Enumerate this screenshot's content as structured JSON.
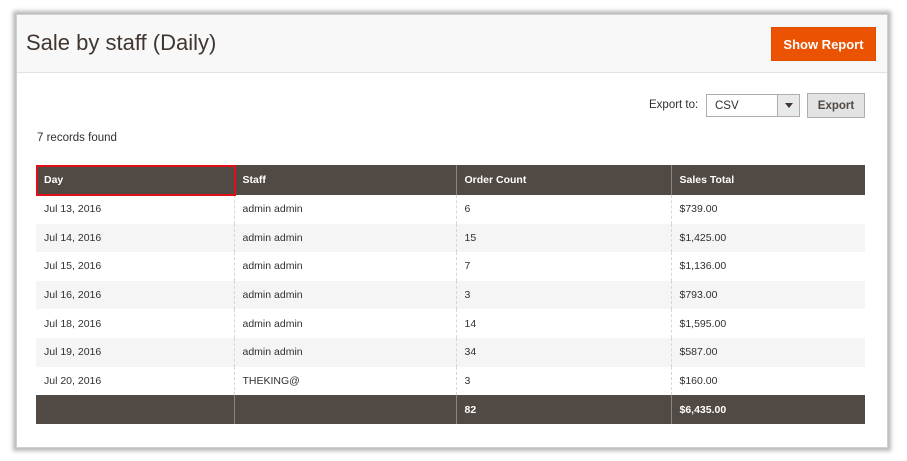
{
  "header": {
    "title": "Sale by staff (Daily)",
    "show_report_label": "Show Report"
  },
  "toolbar": {
    "export_label": "Export to:",
    "export_format": "CSV",
    "export_button": "Export"
  },
  "records_found": "7 records found",
  "grid": {
    "columns": [
      "Day",
      "Staff",
      "Order Count",
      "Sales Total"
    ],
    "rows": [
      [
        "Jul 13, 2016",
        "admin admin",
        "6",
        "$739.00"
      ],
      [
        "Jul 14, 2016",
        "admin admin",
        "15",
        "$1,425.00"
      ],
      [
        "Jul 15, 2016",
        "admin admin",
        "7",
        "$1,136.00"
      ],
      [
        "Jul 16, 2016",
        "admin admin",
        "3",
        "$793.00"
      ],
      [
        "Jul 18, 2016",
        "admin admin",
        "14",
        "$1,595.00"
      ],
      [
        "Jul 19, 2016",
        "admin admin",
        "34",
        "$587.00"
      ],
      [
        "Jul 20, 2016",
        "THEKING@",
        "3",
        "$160.00"
      ]
    ],
    "totals": [
      "",
      "",
      "82",
      "$6,435.00"
    ]
  },
  "colors": {
    "accent": "#eb5202",
    "grid_header": "#514943",
    "highlight": "#e0101a"
  }
}
